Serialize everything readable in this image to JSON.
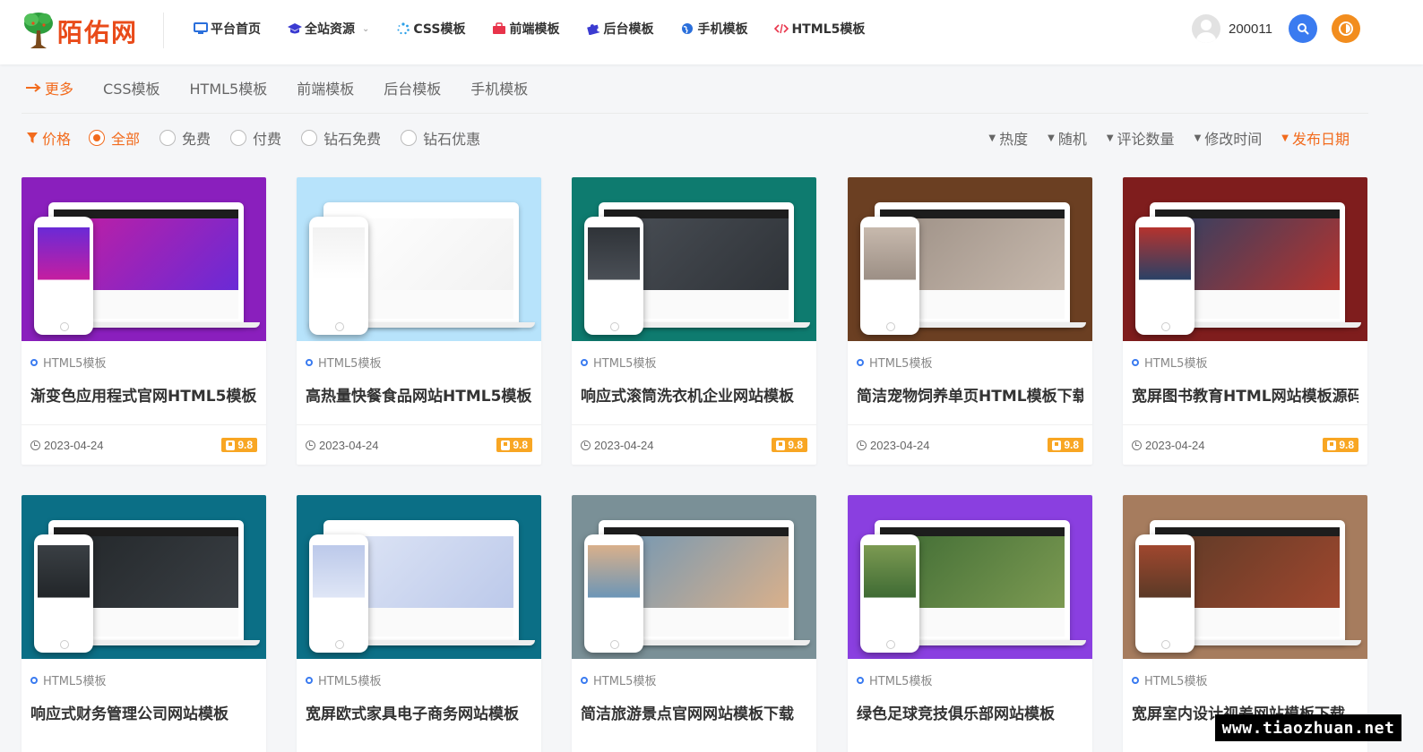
{
  "header": {
    "logo_text": "陌佑网",
    "nav": [
      {
        "label": "平台首页",
        "icon": "monitor-icon",
        "color": "#2a6fdb"
      },
      {
        "label": "全站资源",
        "icon": "graduation-cap-icon",
        "color": "#3b3bd1",
        "has_dropdown": true
      },
      {
        "label": "CSS模板",
        "icon": "spinner-icon",
        "color": "#2a9fe8"
      },
      {
        "label": "前端模板",
        "icon": "briefcase-icon",
        "color": "#e8334a"
      },
      {
        "label": "后台模板",
        "icon": "puzzle-icon",
        "color": "#3b3bd1"
      },
      {
        "label": "手机模板",
        "icon": "globe-icon",
        "color": "#2a6fdb"
      },
      {
        "label": "HTML5模板",
        "icon": "code-icon",
        "color": "#e8334a"
      }
    ],
    "username": "200011"
  },
  "categories": {
    "more_label": "更多",
    "items": [
      "CSS模板",
      "HTML5模板",
      "前端模板",
      "后台模板",
      "手机模板"
    ]
  },
  "filters": {
    "price_label": "价格",
    "options": [
      "全部",
      "免费",
      "付费",
      "钻石免费",
      "钻石优惠"
    ],
    "selected": "全部",
    "sorts": [
      "热度",
      "随机",
      "评论数量",
      "修改时间",
      "发布日期"
    ],
    "active_sort": "发布日期"
  },
  "cards": [
    {
      "category": "HTML5模板",
      "title": "渐变色应用程式官网HTML5模板",
      "date": "2023-04-24",
      "price": "9.8",
      "bg": "#8a1fbd",
      "screen": "#c51ea0",
      "screen2": "#6a2ad6"
    },
    {
      "category": "HTML5模板",
      "title": "高热量快餐食品网站HTML5模板",
      "date": "2023-04-24",
      "price": "9.8",
      "bg": "#b7e3fb",
      "screen": "#ffffff",
      "screen2": "#f2f2f2"
    },
    {
      "category": "HTML5模板",
      "title": "响应式滚筒洗衣机企业网站模板",
      "date": "2023-04-24",
      "price": "9.8",
      "bg": "#0e7b6f",
      "screen": "#4a4f56",
      "screen2": "#2f3338"
    },
    {
      "category": "HTML5模板",
      "title": "简洁宠物饲养单页HTML模板下载",
      "date": "2023-04-24",
      "price": "9.8",
      "bg": "#6b3f22",
      "screen": "#9c8f85",
      "screen2": "#c7b9ad"
    },
    {
      "category": "HTML5模板",
      "title": "宽屏图书教育HTML网站模板源码",
      "date": "2023-04-24",
      "price": "9.8",
      "bg": "#7f1d1d",
      "screen": "#2a4166",
      "screen2": "#b5332e"
    },
    {
      "category": "HTML5模板",
      "title": "响应式财务管理公司网站模板",
      "date": "",
      "price": "",
      "bg": "#0b6f86",
      "screen": "#222629",
      "screen2": "#3a3f44"
    },
    {
      "category": "HTML5模板",
      "title": "宽屏欧式家具电子商务网站模板",
      "date": "",
      "price": "",
      "bg": "#0b6f86",
      "screen": "#dfe6f6",
      "screen2": "#bcc9ea"
    },
    {
      "category": "HTML5模板",
      "title": "简洁旅游景点官网网站模板下载",
      "date": "",
      "price": "",
      "bg": "#7a9097",
      "screen": "#6d96b6",
      "screen2": "#d9b08b"
    },
    {
      "category": "HTML5模板",
      "title": "绿色足球竞技俱乐部网站模板",
      "date": "",
      "price": "",
      "bg": "#8a3fe0",
      "screen": "#3f6b34",
      "screen2": "#7c9a52"
    },
    {
      "category": "HTML5模板",
      "title": "宽屏室内设计视差网站模板下载",
      "date": "",
      "price": "",
      "bg": "#a67c5e",
      "screen": "#5b3a27",
      "screen2": "#a0472e"
    }
  ],
  "watermark": "www.tiaozhuan.net"
}
